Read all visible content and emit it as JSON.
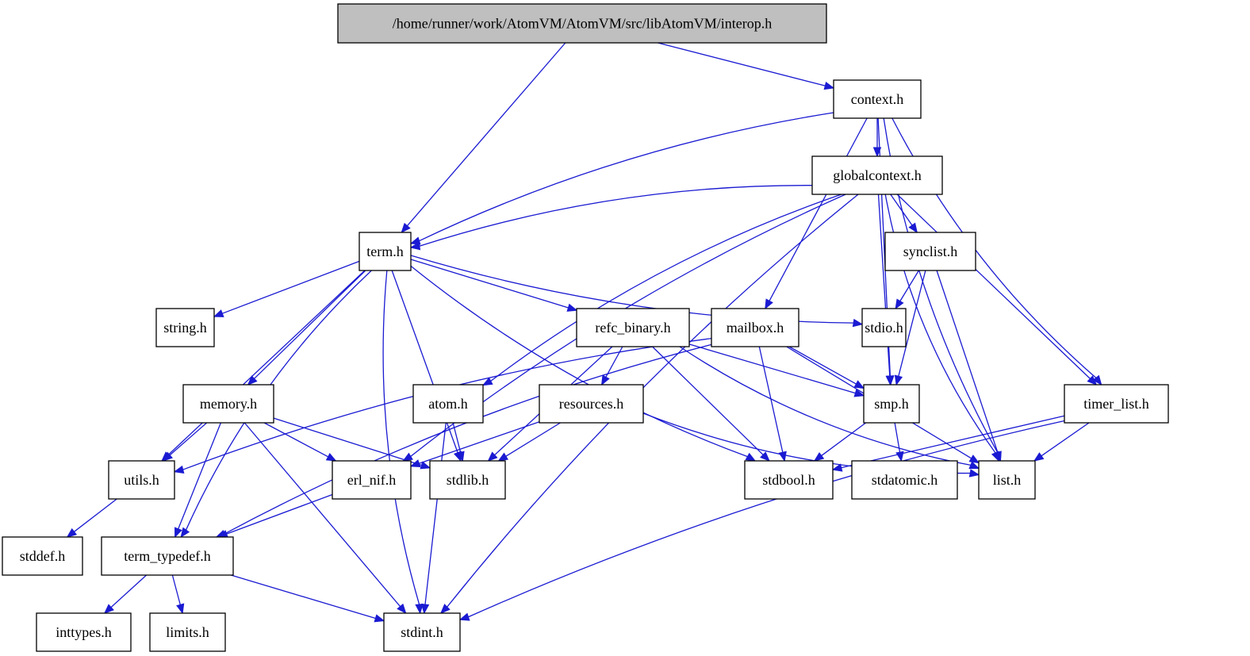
{
  "title": "/home/runner/work/AtomVM/AtomVM/src/libAtomVM/interop.h",
  "colors": {
    "root_fill": "#bfbfbf",
    "node_fill": "#ffffff",
    "node_stroke": "#000000",
    "edge": "#1a1ad2"
  },
  "nodes": [
    {
      "id": "interop",
      "label": "/home/runner/work/AtomVM/AtomVM/src/libAtomVM/interop.h",
      "root": true
    },
    {
      "id": "context",
      "label": "context.h"
    },
    {
      "id": "globalcontext",
      "label": "globalcontext.h"
    },
    {
      "id": "term",
      "label": "term.h"
    },
    {
      "id": "synclist",
      "label": "synclist.h"
    },
    {
      "id": "string",
      "label": "string.h"
    },
    {
      "id": "refc_binary",
      "label": "refc_binary.h"
    },
    {
      "id": "mailbox",
      "label": "mailbox.h"
    },
    {
      "id": "stdio",
      "label": "stdio.h"
    },
    {
      "id": "memory",
      "label": "memory.h"
    },
    {
      "id": "atom",
      "label": "atom.h"
    },
    {
      "id": "resources",
      "label": "resources.h"
    },
    {
      "id": "smp",
      "label": "smp.h"
    },
    {
      "id": "timer_list",
      "label": "timer_list.h"
    },
    {
      "id": "utils",
      "label": "utils.h"
    },
    {
      "id": "erl_nif",
      "label": "erl_nif.h"
    },
    {
      "id": "stdlib",
      "label": "stdlib.h"
    },
    {
      "id": "stdbool",
      "label": "stdbool.h"
    },
    {
      "id": "stdatomic",
      "label": "stdatomic.h"
    },
    {
      "id": "list",
      "label": "list.h"
    },
    {
      "id": "stddef",
      "label": "stddef.h"
    },
    {
      "id": "term_typedef",
      "label": "term_typedef.h"
    },
    {
      "id": "inttypes",
      "label": "inttypes.h"
    },
    {
      "id": "limits",
      "label": "limits.h"
    },
    {
      "id": "stdint",
      "label": "stdint.h"
    }
  ],
  "edges": [
    [
      "interop",
      "term"
    ],
    [
      "interop",
      "context"
    ],
    [
      "context",
      "globalcontext"
    ],
    [
      "context",
      "term"
    ],
    [
      "context",
      "mailbox"
    ],
    [
      "context",
      "smp"
    ],
    [
      "context",
      "timer_list"
    ],
    [
      "context",
      "list"
    ],
    [
      "globalcontext",
      "term"
    ],
    [
      "globalcontext",
      "synclist"
    ],
    [
      "globalcontext",
      "atom"
    ],
    [
      "globalcontext",
      "erl_nif"
    ],
    [
      "globalcontext",
      "smp"
    ],
    [
      "globalcontext",
      "timer_list"
    ],
    [
      "globalcontext",
      "list"
    ],
    [
      "globalcontext",
      "stdint"
    ],
    [
      "term",
      "string"
    ],
    [
      "term",
      "refc_binary"
    ],
    [
      "term",
      "stdio"
    ],
    [
      "term",
      "memory"
    ],
    [
      "term",
      "utils"
    ],
    [
      "term",
      "term_typedef"
    ],
    [
      "term",
      "stdint"
    ],
    [
      "term",
      "stdlib"
    ],
    [
      "term",
      "stdbool"
    ],
    [
      "synclist",
      "stdio"
    ],
    [
      "synclist",
      "smp"
    ],
    [
      "synclist",
      "list"
    ],
    [
      "refc_binary",
      "resources"
    ],
    [
      "refc_binary",
      "smp"
    ],
    [
      "refc_binary",
      "stdlib"
    ],
    [
      "refc_binary",
      "stdbool"
    ],
    [
      "refc_binary",
      "list"
    ],
    [
      "mailbox",
      "utils"
    ],
    [
      "mailbox",
      "term_typedef"
    ],
    [
      "mailbox",
      "smp"
    ],
    [
      "mailbox",
      "stdbool"
    ],
    [
      "mailbox",
      "list"
    ],
    [
      "memory",
      "utils"
    ],
    [
      "memory",
      "term_typedef"
    ],
    [
      "memory",
      "erl_nif"
    ],
    [
      "memory",
      "stdlib"
    ],
    [
      "memory",
      "stdint"
    ],
    [
      "atom",
      "stdlib"
    ],
    [
      "atom",
      "stdint"
    ],
    [
      "resources",
      "erl_nif"
    ],
    [
      "resources",
      "stdlib"
    ],
    [
      "resources",
      "list"
    ],
    [
      "smp",
      "stdbool"
    ],
    [
      "smp",
      "stdatomic"
    ],
    [
      "timer_list",
      "stdbool"
    ],
    [
      "timer_list",
      "list"
    ],
    [
      "timer_list",
      "stdint"
    ],
    [
      "utils",
      "stddef"
    ],
    [
      "erl_nif",
      "term_typedef"
    ],
    [
      "term_typedef",
      "inttypes"
    ],
    [
      "term_typedef",
      "limits"
    ],
    [
      "term_typedef",
      "stdint"
    ]
  ]
}
